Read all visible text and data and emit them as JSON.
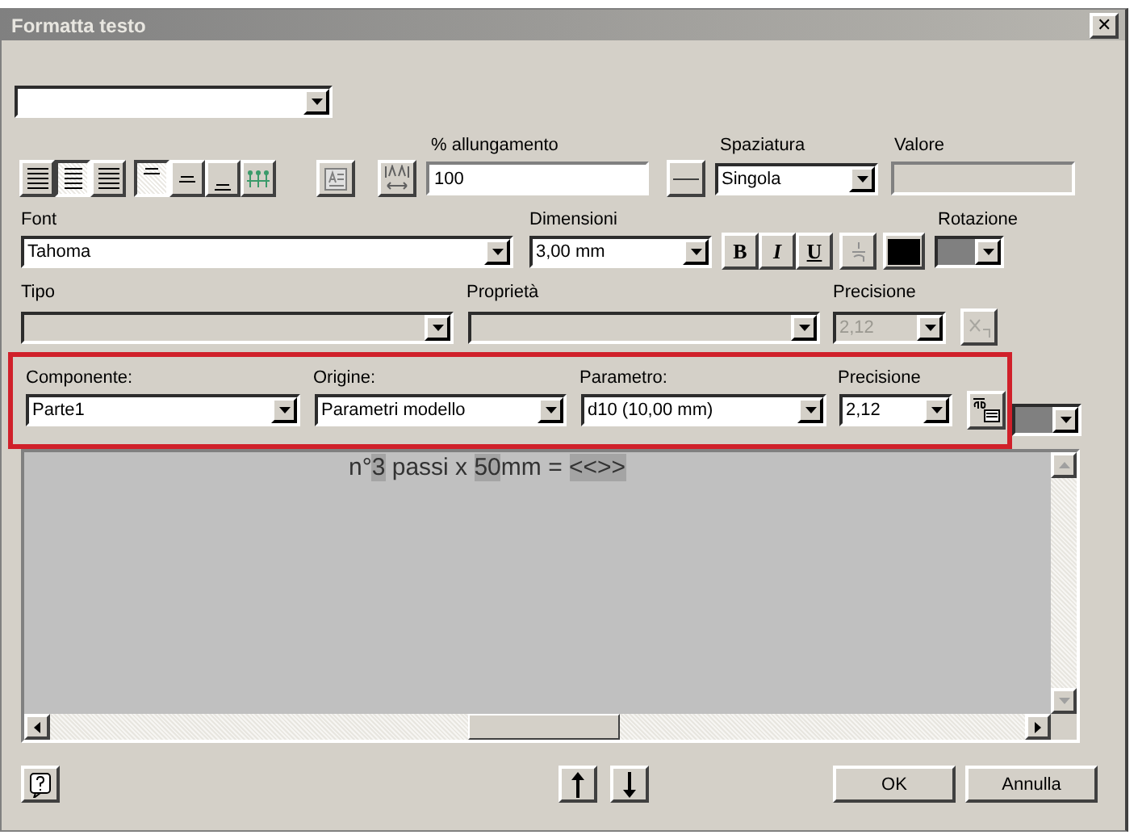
{
  "window": {
    "title": "Formatta testo",
    "close": "✕"
  },
  "alignment": [
    {
      "kind": "left",
      "selected": false
    },
    {
      "kind": "center",
      "selected": true
    },
    {
      "kind": "right",
      "selected": false
    }
  ],
  "vertical_alignment": [
    {
      "kind": "top",
      "selected": true
    },
    {
      "kind": "middle",
      "selected": false
    },
    {
      "kind": "bottom",
      "selected": false
    }
  ],
  "stretch": {
    "label": "% allungamento",
    "value": "100"
  },
  "spacing": {
    "label": "Spaziatura",
    "value": "Singola"
  },
  "spacing_value": {
    "label": "Valore",
    "disabled": true
  },
  "font": {
    "label": "Font",
    "value": "Tahoma"
  },
  "size": {
    "label": "Dimensioni",
    "value": "3,00 mm"
  },
  "styles": [
    {
      "label": "B",
      "kind": "bold",
      "selected": false
    },
    {
      "label": "I",
      "kind": "italic",
      "selected": false
    },
    {
      "label": "U",
      "kind": "underline",
      "selected": false
    }
  ],
  "text_color": {
    "color": "#000000"
  },
  "rotation": {
    "label": "Rotazione"
  },
  "type": {
    "label": "Tipo",
    "disabled": true
  },
  "property": {
    "label": "Proprietà",
    "disabled": true
  },
  "precision_top": {
    "label": "Precisione",
    "value": "2,12",
    "disabled": true
  },
  "parameter_row": [
    {
      "label": "Componente:",
      "value": "Parte1"
    },
    {
      "label": "Origine:",
      "value": "Parametri modello"
    },
    {
      "label": "Parametro:",
      "value": "d10 (10,00 mm)"
    },
    {
      "label": "Precisione",
      "value": "2,12"
    }
  ],
  "editor": {
    "segments": [
      {
        "text": "n°",
        "highlight": false
      },
      {
        "text": "3",
        "highlight": true
      },
      {
        "text": " passi x ",
        "highlight": false
      },
      {
        "text": "50",
        "highlight": true
      },
      {
        "text": "mm = ",
        "highlight": false
      },
      {
        "text": "<<>>",
        "highlight": true
      }
    ]
  },
  "buttons": [
    {
      "label": "OK"
    },
    {
      "label": "Annulla"
    }
  ]
}
